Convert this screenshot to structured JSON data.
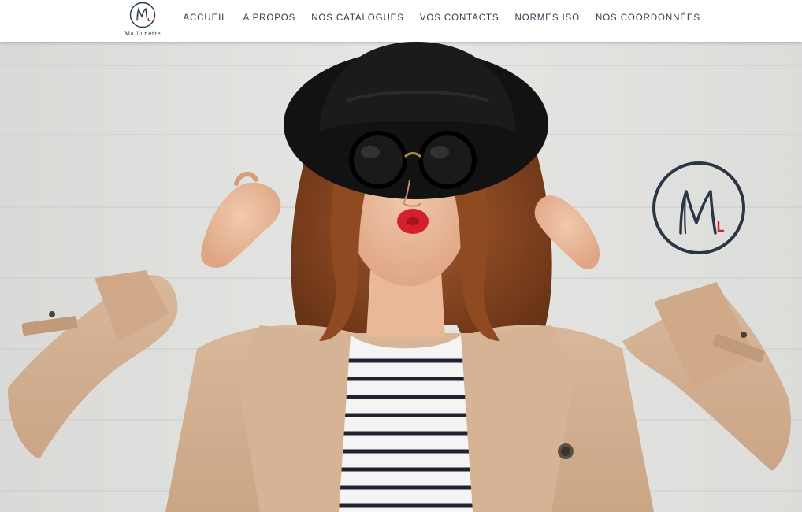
{
  "brand": {
    "logo_text_main": "Ma ",
    "logo_text_accent": "L",
    "logo_text_rest": "unette",
    "colors": {
      "navy": "#2b3645",
      "accent_red": "#d1242b",
      "nav_text": "#2f3a4a"
    }
  },
  "nav": {
    "items": [
      {
        "label": "ACCUEIL"
      },
      {
        "label": "A PROPOS"
      },
      {
        "label": "NOS CATALOGUES"
      },
      {
        "label": "VOS CONTACTS"
      },
      {
        "label": "NORMES ISO"
      },
      {
        "label": "NOS COORDONNÉES"
      }
    ]
  },
  "hero": {
    "image": "woman-in-hat-sunglasses-photo",
    "badge_icon": "ml-monogram-icon"
  }
}
